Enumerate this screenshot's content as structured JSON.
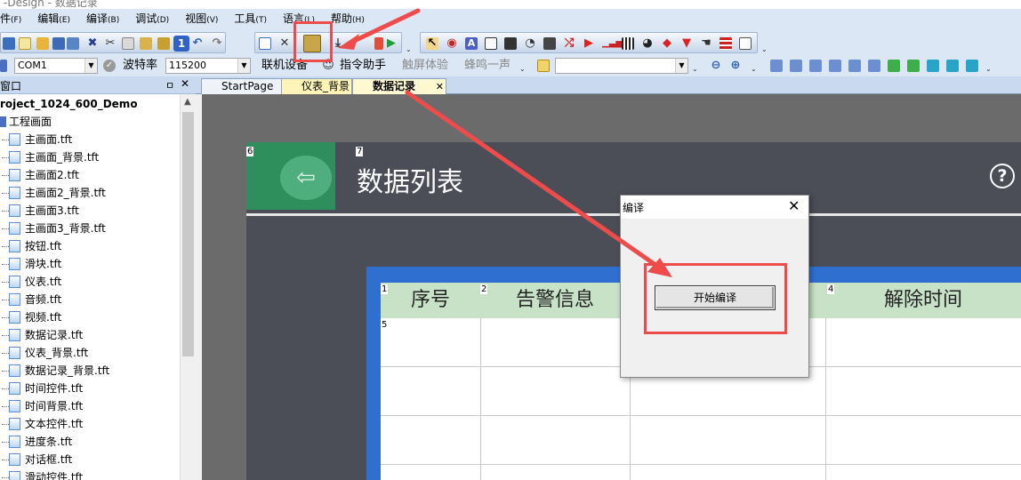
{
  "window": {
    "title": "-Design - 数据记录"
  },
  "menu": [
    {
      "label": "件",
      "key": "F"
    },
    {
      "label": "编辑",
      "key": "E"
    },
    {
      "label": "编译",
      "key": "B"
    },
    {
      "label": "调试",
      "key": "D"
    },
    {
      "label": "视图",
      "key": "V"
    },
    {
      "label": "工具",
      "key": "T"
    },
    {
      "label": "语言",
      "key": "L"
    },
    {
      "label": "帮助",
      "key": "H"
    }
  ],
  "toolbar2": {
    "port_value": "COM1",
    "baud_label": "波特率",
    "baud_value": "115200",
    "connect_label": "联机设备",
    "assistant_label": "指令助手",
    "touch_label": "触屏体验",
    "beep_label": "蜂鸣一声"
  },
  "panel": {
    "title": "窗口",
    "pin": "ㅁ",
    "close": "✕",
    "root": "roject_1024_600_Demo",
    "group": "工程画面",
    "files": [
      "主画面.tft",
      "主画面_背景.tft",
      "主画面2.tft",
      "主画面2_背景.tft",
      "主画面3.tft",
      "主画面3_背景.tft",
      "按钮.tft",
      "滑块.tft",
      "仪表.tft",
      "音频.tft",
      "视频.tft",
      "数据记录.tft",
      "仪表_背景.tft",
      "数据记录_背景.tft",
      "时间控件.tft",
      "时间背景.tft",
      "文本控件.tft",
      "进度条.tft",
      "对话框.tft",
      "滑动控件.tft"
    ]
  },
  "tabs": [
    {
      "label": "StartPage"
    },
    {
      "label": "仪表_背景"
    },
    {
      "label": "数据记录",
      "close": "✕"
    }
  ],
  "screen": {
    "title": "数据列表",
    "help": "?",
    "ids": {
      "back": "6",
      "title": "7",
      "c1": "1",
      "c2": "2",
      "c4": "4",
      "body": "5"
    },
    "columns": [
      "序号",
      "告警信息",
      "",
      "解除时间"
    ]
  },
  "dialog": {
    "title": "编译",
    "close": "✕",
    "start_button": "开始编译"
  },
  "colors": {
    "annotation_red": "#ee4b4b",
    "screen_bg": "#4b4d57",
    "back_green": "#2f8f5c",
    "table_header": "#c8e2c8",
    "table_frame": "#2f6fd0"
  }
}
